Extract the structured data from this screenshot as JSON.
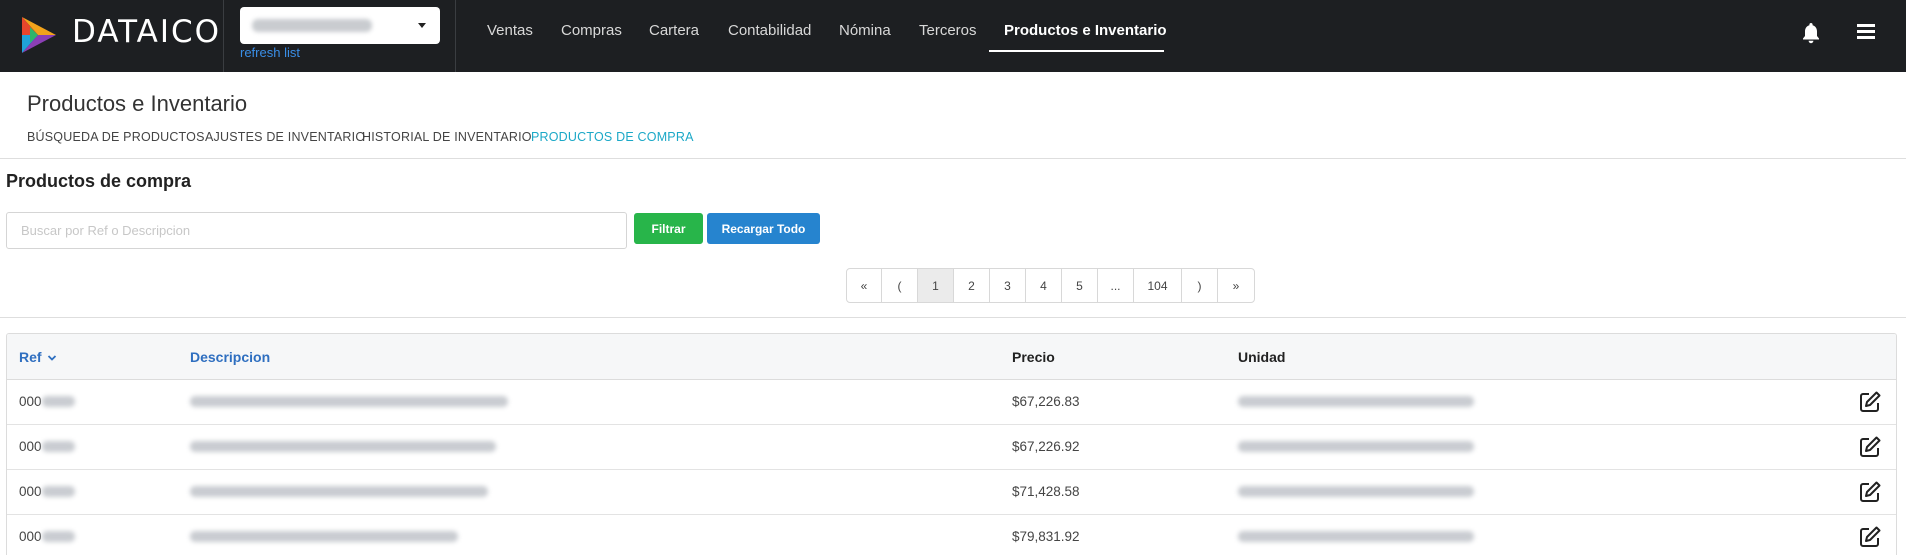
{
  "app": {
    "brand": "DATAICO",
    "refresh_label": "refresh list",
    "colors": {
      "topbar": "#1d1f22",
      "accent_tab": "#1ba8c7",
      "filter_button": "#28b54a",
      "reload_button": "#2684cf",
      "link": "#2f6fc0"
    }
  },
  "nav": {
    "items": [
      {
        "label": "Ventas"
      },
      {
        "label": "Compras"
      },
      {
        "label": "Cartera"
      },
      {
        "label": "Contabilidad"
      },
      {
        "label": "Nómina"
      },
      {
        "label": "Terceros"
      },
      {
        "label": "Productos e Inventario",
        "active": true
      }
    ],
    "icons": [
      "bell-icon",
      "menu-icon"
    ]
  },
  "page": {
    "title": "Productos e Inventario",
    "tabs": [
      {
        "label": "BÚSQUEDA DE PRODUCTOS"
      },
      {
        "label": "AJUSTES DE INVENTARIO"
      },
      {
        "label": "HISTORIAL DE INVENTARIO"
      },
      {
        "label": "PRODUCTOS DE COMPRA",
        "active": true
      }
    ]
  },
  "section": {
    "title": "Productos de compra",
    "search_placeholder": "Buscar por Ref o Descripcion",
    "filter_label": "Filtrar",
    "reload_label": "Recargar Todo"
  },
  "pagination": {
    "items": [
      "«",
      "(",
      "1",
      "2",
      "3",
      "4",
      "5",
      "...",
      "104",
      ")",
      "»"
    ],
    "current": "1"
  },
  "table": {
    "headers": {
      "ref": "Ref",
      "descripcion": "Descripcion",
      "precio": "Precio",
      "unidad": "Unidad"
    },
    "sort_column": "ref",
    "rows": [
      {
        "ref": "000",
        "precio": "$67,226.83"
      },
      {
        "ref": "000",
        "precio": "$67,226.92"
      },
      {
        "ref": "000",
        "precio": "$71,428.58"
      },
      {
        "ref": "000",
        "precio": "$79,831.92"
      }
    ]
  }
}
